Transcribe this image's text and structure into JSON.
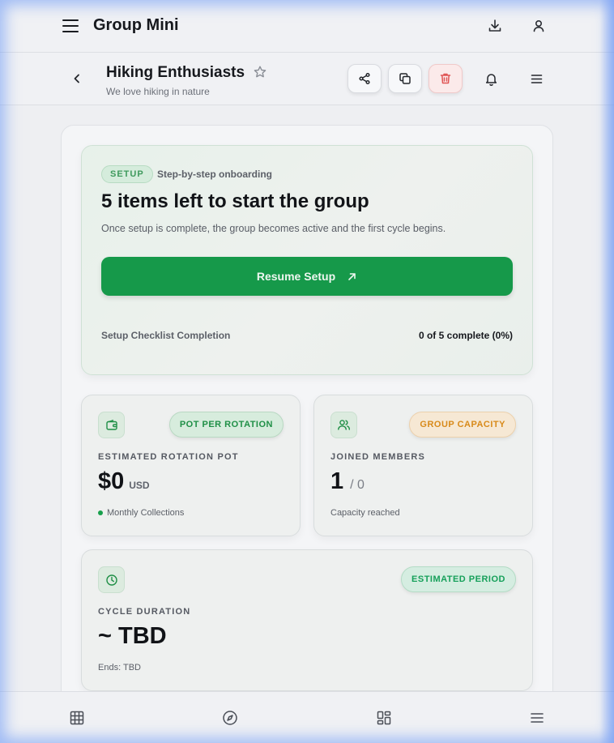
{
  "appbar": {
    "title": "Group Mini",
    "icons": [
      "menu-icon",
      "download-icon",
      "user-icon"
    ]
  },
  "group": {
    "name": "Hiking Enthusiasts",
    "description": "We love hiking in nature",
    "actions": [
      "share-icon",
      "copy-icon",
      "trash-icon",
      "bell-icon",
      "list-icon"
    ]
  },
  "setup": {
    "badge": "SETUP",
    "subtitle": "Step-by-step onboarding",
    "title": "5 items left to start the group",
    "text": "Once setup is complete, the group becomes active and the first cycle begins.",
    "button_label": "Resume Setup",
    "checklist_label": "Setup Checklist Completion",
    "checklist_value": "0 of 5 complete (0%)",
    "completed": 0,
    "total": 5
  },
  "stats": {
    "pot": {
      "pill": "POT PER ROTATION",
      "label": "ESTIMATED ROTATION POT",
      "value": "$0",
      "unit": "USD",
      "foot": "Monthly Collections"
    },
    "capacity": {
      "pill": "GROUP CAPACITY",
      "label": "JOINED MEMBERS",
      "value": "1",
      "denom": "/ 0",
      "foot": "Capacity reached"
    },
    "cycle": {
      "pill": "ESTIMATED PERIOD",
      "label": "CYCLE DURATION",
      "value": "~ TBD",
      "foot": "Ends: TBD"
    }
  },
  "bottomnav": {
    "icons": [
      "grid-icon",
      "compass-icon",
      "dashboard-icon",
      "menu-icon"
    ]
  },
  "colors": {
    "primary_green": "#16994a",
    "danger": "#e05555",
    "warning": "#d88a1a"
  }
}
